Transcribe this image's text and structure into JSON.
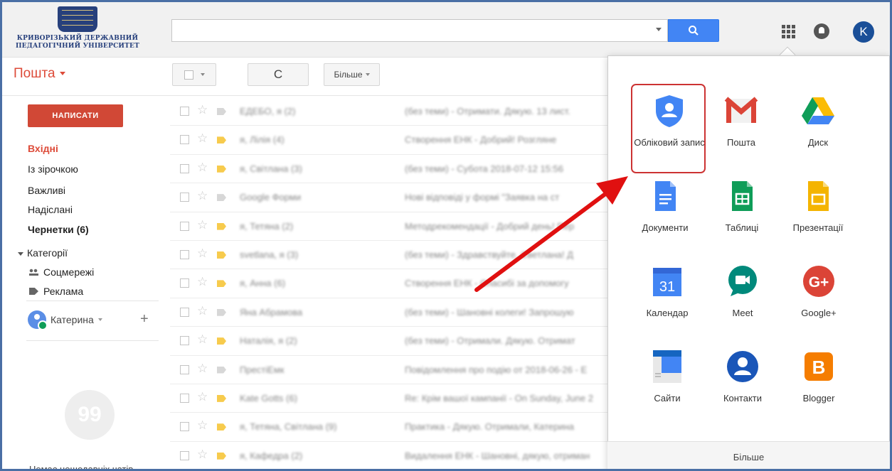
{
  "header": {
    "logo_line1": "КРИВОРІЗЬКИЙ ДЕРЖАВНИЙ",
    "logo_line2": "ПЕДАГОГІЧНИЙ УНІВЕРСИТЕТ",
    "search_value": "",
    "avatar_letter": "K"
  },
  "toolbar": {
    "mail_title": "Пошта",
    "refresh_glyph": "C",
    "more_label": "Більше"
  },
  "sidebar": {
    "compose_label": "НАПИСАТИ",
    "inbox": "Вхідні",
    "starred": "Із зірочкою",
    "important": "Важливі",
    "sent": "Надіслані",
    "drafts": "Чернетки (6)",
    "categories": "Категорії",
    "social": "Соцмережі",
    "promotions": "Реклама",
    "user_name": "Катерина",
    "add_symbol": "+",
    "hangouts_glyph": "99",
    "no_chats": "Немає нещодавніх чатів"
  },
  "emails": [
    {
      "sender": "ЕДЕБО, я (2)",
      "subject": "(без теми) - Отримати. Дякую. 13 лист.",
      "tag": "empty"
    },
    {
      "sender": "я, Лілія (4)",
      "subject": "Створення ЕНК - Добрий! Розгляне",
      "tag": "yellow"
    },
    {
      "sender": "я, Світлана (3)",
      "subject": "(без теми) - Субота 2018-07-12 15:56",
      "tag": "yellow"
    },
    {
      "sender": "Google Форми",
      "subject": "Нові відповіді у формі \"Заявка на ст",
      "tag": "empty"
    },
    {
      "sender": "я, Тетяна (2)",
      "subject": "Методрекомендації - Добрий день! Пер",
      "tag": "yellow"
    },
    {
      "sender": "svetlana, я (3)",
      "subject": "(без теми) - Здравствуйте, Светлана! Д",
      "tag": "yellow"
    },
    {
      "sender": "я, Анна (6)",
      "subject": "Створення ЕНК - Спасибі за допомогу",
      "tag": "yellow"
    },
    {
      "sender": "Яна Абрамова",
      "subject": "(без теми) - Шановні колеги! Запрошую",
      "tag": "empty"
    },
    {
      "sender": "Наталія, я (2)",
      "subject": "(без теми) - Отримали. Дякую. Отримат",
      "tag": "yellow"
    },
    {
      "sender": "ПрестіЕмк",
      "subject": "Повідомлення про подію от 2018-06-26 - Е",
      "tag": "empty"
    },
    {
      "sender": "Kate Gotts (6)",
      "subject": "Re: Крім вашої кампанії - On Sunday, June 2",
      "tag": "yellow"
    },
    {
      "sender": "я, Тетяна, Світлана (9)",
      "subject": "Практика - Дякую. Отримали, Катерина",
      "tag": "yellow"
    },
    {
      "sender": "я, Кафедра (2)",
      "subject": "Видалення ЕНК - Шановні, дякую, отриман",
      "tag": "yellow"
    }
  ],
  "apps": [
    {
      "name": "account",
      "label": "Обліковий запис",
      "icon": "account-shield-icon"
    },
    {
      "name": "mail",
      "label": "Пошта",
      "icon": "gmail-icon"
    },
    {
      "name": "drive",
      "label": "Диск",
      "icon": "drive-icon"
    },
    {
      "name": "docs",
      "label": "Документи",
      "icon": "docs-icon"
    },
    {
      "name": "sheets",
      "label": "Таблиці",
      "icon": "sheets-icon"
    },
    {
      "name": "slides",
      "label": "Презентації",
      "icon": "slides-icon"
    },
    {
      "name": "calendar",
      "label": "Календар",
      "icon": "calendar-icon",
      "badge": "31"
    },
    {
      "name": "meet",
      "label": "Meet",
      "icon": "meet-icon"
    },
    {
      "name": "gplus",
      "label": "Google+",
      "icon": "google-plus-icon",
      "badge": "G+"
    },
    {
      "name": "sites",
      "label": "Сайти",
      "icon": "sites-icon"
    },
    {
      "name": "contacts",
      "label": "Контакти",
      "icon": "contacts-icon"
    },
    {
      "name": "blogger",
      "label": "Blogger",
      "icon": "blogger-icon",
      "badge": "B"
    }
  ],
  "apps_more_label": "Більше",
  "colors": {
    "accent_red": "#dd4b39",
    "compose_red": "#d14836",
    "search_blue": "#4285f4",
    "highlight_red": "#cc3333",
    "arrow_red": "#e01010"
  }
}
